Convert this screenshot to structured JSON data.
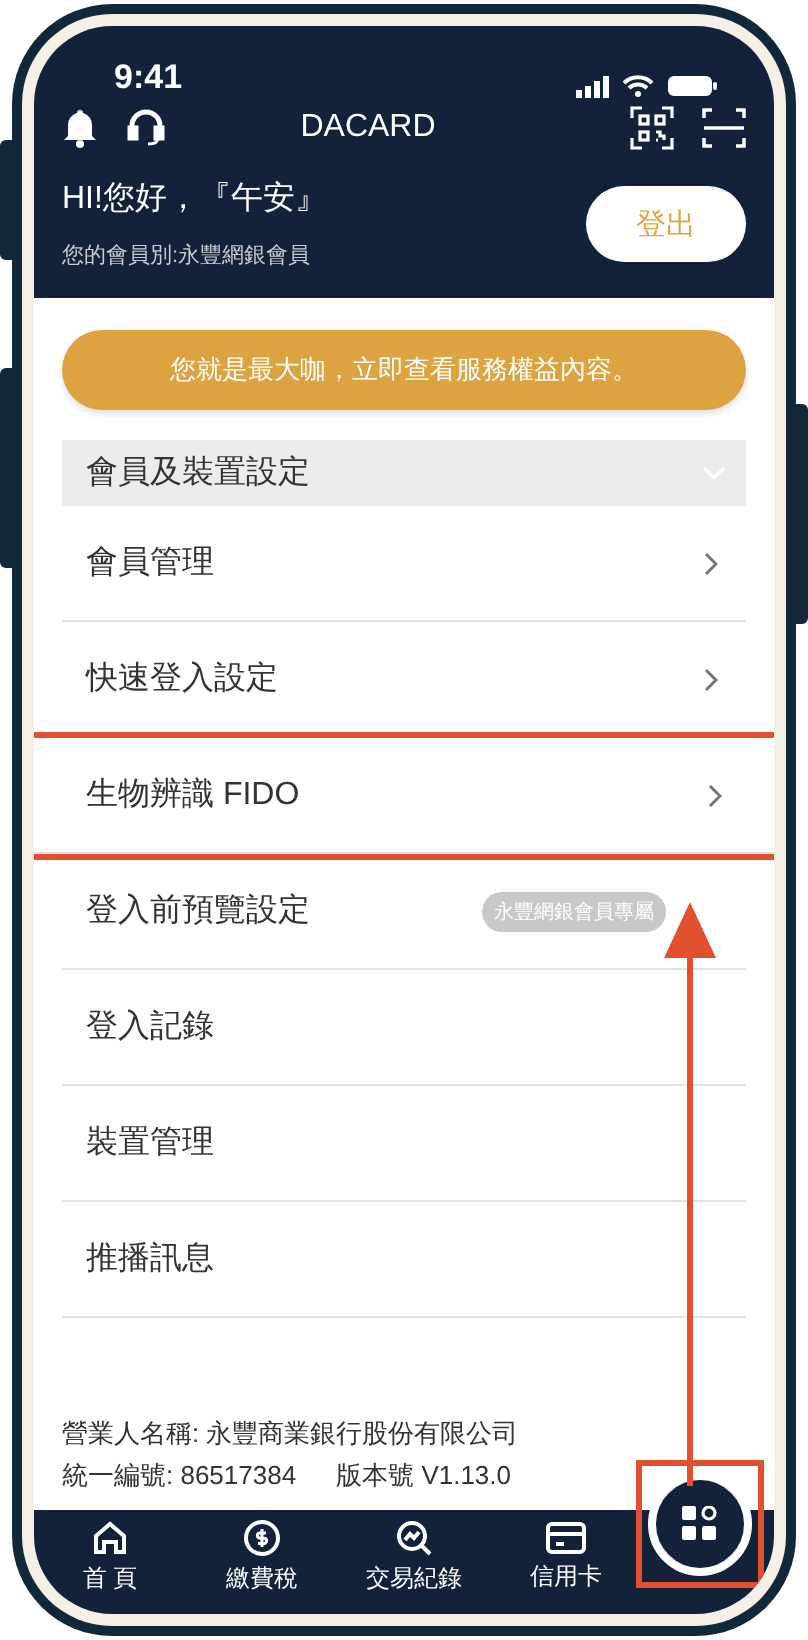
{
  "status_bar": {
    "time": "9:41"
  },
  "app_bar": {
    "title": "DACARD"
  },
  "greeting": {
    "title": "HI!您好，『午安』",
    "subtitle": "您的會員別:永豐網銀會員",
    "logout_button": "登出"
  },
  "banner": {
    "text": "您就是最大咖，立即查看服務權益內容。"
  },
  "section": {
    "title": "會員及裝置設定",
    "expanded": true
  },
  "menu_items": [
    {
      "label": "會員管理",
      "chevron": true,
      "highlighted": false
    },
    {
      "label": "快速登入設定",
      "chevron": true,
      "highlighted": false
    },
    {
      "label": "生物辨識 FIDO",
      "chevron": true,
      "highlighted": true
    },
    {
      "label": "登入前預覽設定",
      "badge": "永豐網銀會員專屬",
      "chevron": false,
      "highlighted": false
    },
    {
      "label": "登入記錄",
      "chevron": false,
      "highlighted": false
    },
    {
      "label": "裝置管理",
      "chevron": false,
      "highlighted": false
    },
    {
      "label": "推播訊息",
      "chevron": false,
      "highlighted": false
    }
  ],
  "footer": {
    "company": "營業人名稱: 永豐商業銀行股份有限公司",
    "tax_id": "統一編號: 86517384",
    "version": "版本號 V1.13.0"
  },
  "tab_bar": [
    {
      "kind": "home",
      "label": "首 頁"
    },
    {
      "kind": "dollar",
      "label": "繳費稅"
    },
    {
      "kind": "chart",
      "label": "交易紀錄"
    },
    {
      "kind": "card",
      "label": "信用卡"
    }
  ],
  "menu_button": {
    "highlighted": true
  }
}
